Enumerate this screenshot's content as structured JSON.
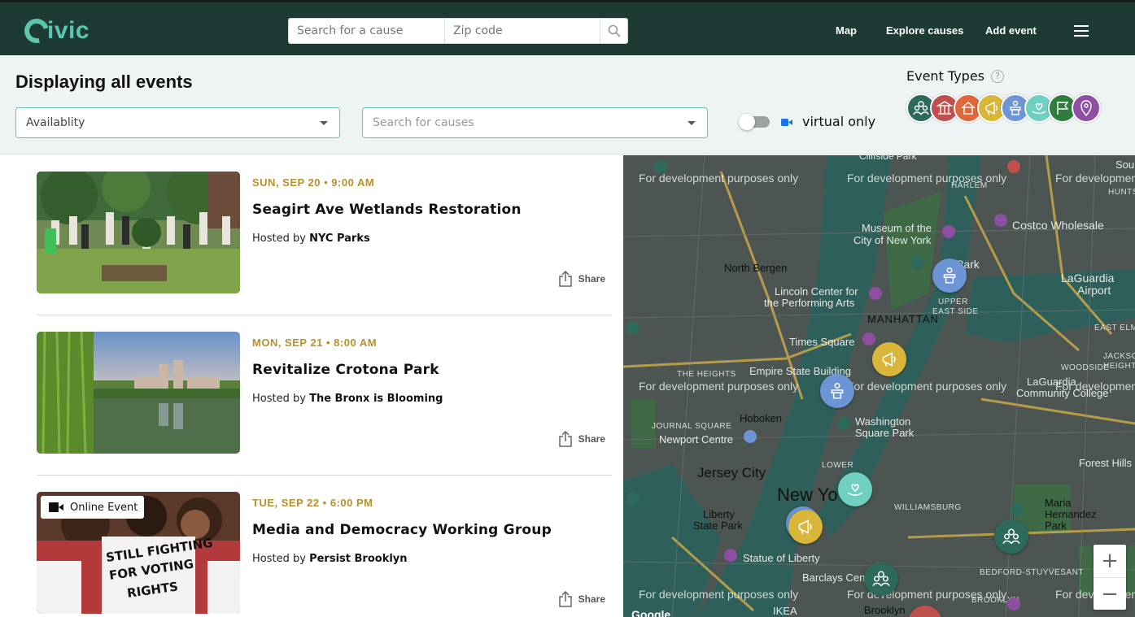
{
  "header": {
    "logo_text": "ivic",
    "search_cause_placeholder": "Search for a cause",
    "search_zip_placeholder": "Zip code",
    "nav": {
      "map": "Map",
      "explore": "Explore causes",
      "add_event": "Add event"
    }
  },
  "filters": {
    "title": "Displaying all events",
    "availability": "Availablity",
    "causes_placeholder": "Search for causes",
    "virtual_label": "virtual only",
    "event_types_label": "Event Types",
    "help": "?",
    "type_icons": [
      {
        "name": "community-icon",
        "color": "#2d6a5c"
      },
      {
        "name": "government-icon",
        "color": "#c0504d"
      },
      {
        "name": "house-icon",
        "color": "#e0673a"
      },
      {
        "name": "megaphone-icon",
        "color": "#d8b63a"
      },
      {
        "name": "podium-icon",
        "color": "#6d95d6"
      },
      {
        "name": "heart-hand-icon",
        "color": "#6fcfc0"
      },
      {
        "name": "flag-icon",
        "color": "#2e7d3a"
      },
      {
        "name": "location-icon",
        "color": "#8e4fa3"
      }
    ]
  },
  "events": [
    {
      "date": "SUN, SEP 20 • 9:00 AM",
      "title": "Seagirt Ave Wetlands Restoration",
      "hosted_by": "Hosted by",
      "host": "NYC Parks",
      "share": "Share",
      "online": false
    },
    {
      "date": "MON, SEP 21 • 8:00 AM",
      "title": "Revitalize Crotona Park",
      "hosted_by": "Hosted by",
      "host": "The Bronx is Blooming",
      "share": "Share",
      "online": false
    },
    {
      "date": "TUE, SEP 22 • 6:00 PM",
      "title": "Media and Democracy Working Group",
      "hosted_by": "Hosted by",
      "host": "Persist Brooklyn",
      "share": "Share",
      "online": true,
      "online_label": "Online Event",
      "sign_text_1": "STILL FIGHTING",
      "sign_text_2": "FOR VOTING",
      "sign_text_3": "RIGHTS"
    }
  ],
  "map": {
    "dev_notice": "For development purposes only",
    "labels": {
      "north_bergen": "North Bergen",
      "lincoln": "Lincoln Center for",
      "lincoln2": "the Performing Arts",
      "manhattan": "MANHATTAN",
      "times_square": "Times Square",
      "empire": "Empire State Building",
      "hoboken": "Hoboken",
      "jersey_city": "Jersey City",
      "new_york": "New Yo",
      "washington": "Washington",
      "washington2": "Square Park",
      "liberty": "Liberty",
      "liberty2": "State Park",
      "statue": "Statue of Liberty",
      "upper_east": "UPPER",
      "upper_east2": "EAST SIDE",
      "museum": "Museum of the",
      "museum2": "City of New York",
      "costco": "Costco Wholesale",
      "laguardia": "LaGuardia",
      "laguardia2": "Airport",
      "harlem": "HARLEM",
      "williamsburg": "WILLIAMSBURG",
      "brooklyn": "BROOKLYN",
      "maria": "Maria",
      "maria2": "Hernandez",
      "maria3": "Park",
      "forest": "Forest Hills",
      "the_heights": "THE HEIGHTS",
      "journal": "JOURNAL SQUARE",
      "newport": "Newport Centre",
      "lower": "LOWER",
      "barclays": "Barclays Cen",
      "ikea": "IKEA",
      "brooklyn_city": "Brooklyn",
      "woodside": "WOODSIDE",
      "jackson": "JACKSON",
      "jackson2": "HEIGHTS",
      "east_elm": "EAST ELM",
      "bedford": "BEDFORD-STUYVESANT",
      "laguardia_cc": "LaGuardia",
      "laguardia_cc2": "Community College",
      "cliffside": "Cliffside Park",
      "hunts": "HUNTS PO",
      "soun": "Soun",
      "harlem_park": "Park",
      "google": "Google"
    },
    "zoom_in": "+",
    "zoom_out": "−"
  }
}
